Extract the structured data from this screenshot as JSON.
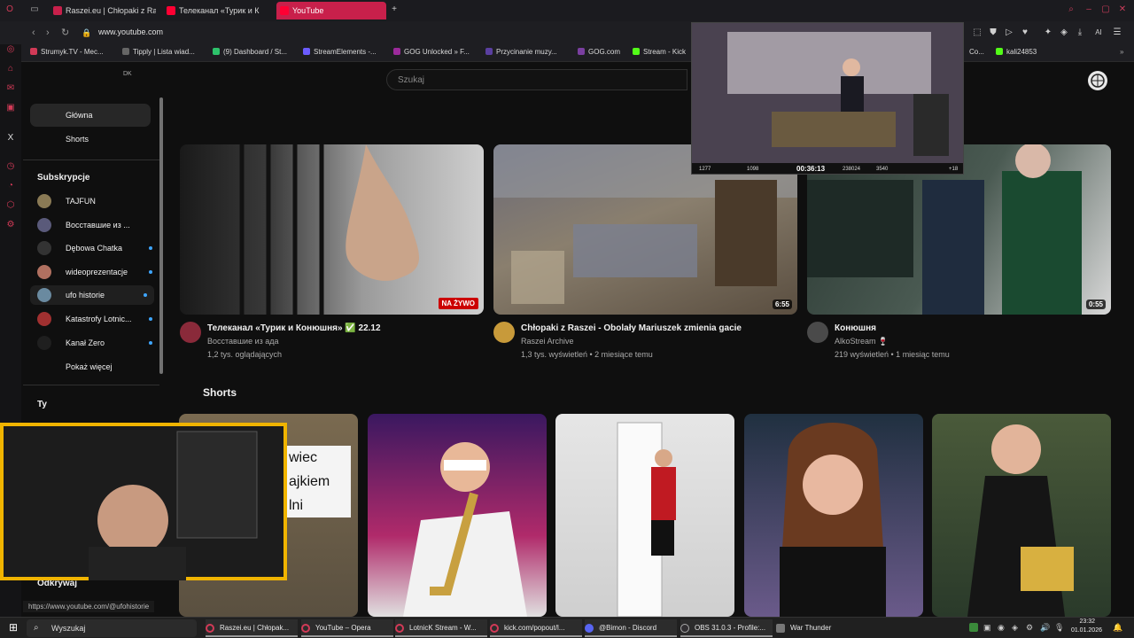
{
  "browser": {
    "tabs": [
      {
        "title": "Raszei.eu | Chłopaki z Ras",
        "active": false
      },
      {
        "title": "Телеканал «Турик и К",
        "active": false
      },
      {
        "title": "YouTube",
        "active": true
      }
    ],
    "url": "www.youtube.com",
    "bookmarks": [
      "Strumyk.TV - Mec...",
      "Tipply | Lista wiad...",
      "(9) Dashboard / St...",
      "StreamElements -...",
      "GOG Unlocked » F...",
      "Przycinanie muzy...",
      "GOG.com",
      "Stream - Kick",
      "Co...",
      "kali24853"
    ],
    "toolbar_ai": "AI",
    "accent": "#c8204b"
  },
  "youtube": {
    "country_code": "DK",
    "search_placeholder": "Szukaj",
    "nav": [
      {
        "label": "Główna",
        "active": true
      },
      {
        "label": "Shorts",
        "active": false
      }
    ],
    "subscriptions_heading": "Subskrypcje",
    "subscriptions": [
      {
        "name": "TAJFUN",
        "live": false,
        "color": "#8a7a55"
      },
      {
        "name": "Восставшие из ...",
        "live": false,
        "color": "#5a5a7a"
      },
      {
        "name": "Dębowa Chatka",
        "live": true,
        "color": "#333333"
      },
      {
        "name": "wideoprezentacje",
        "live": true,
        "color": "#b07060"
      },
      {
        "name": "ufo historie",
        "live": true,
        "color": "#6a8aa0"
      },
      {
        "name": "Katastrofy Lotnic...",
        "live": true,
        "color": "#a03030"
      },
      {
        "name": "Kanał Zero",
        "live": true,
        "color": "#1f1f1f"
      }
    ],
    "show_more": "Pokaż więcej",
    "you_heading": "Ty",
    "discover_heading": "Odkrywaj",
    "status_url": "https://www.youtube.com/@ufohistorie",
    "videos": [
      {
        "title": "Телеканал «Турик и Конюшня» ✅ 22.12",
        "channel": "Восставшие из ада",
        "meta": "1,2 tys. oglądających",
        "badge": "NA ŻYWO",
        "avatar_color": "#8a2a3a"
      },
      {
        "title": "Chłopaki z Raszei - Obolały Mariuszek zmienia gacie",
        "channel": "Raszei Archive",
        "meta": "1,3 tys. wyświetleń • 2 miesiące temu",
        "duration": "6:55",
        "avatar_color": "#c89a3a"
      },
      {
        "title": "Конюшня",
        "channel": "AlkoStream 🍷",
        "meta": "219 wyświetleń • 1 miesiąc temu",
        "duration": "0:55",
        "avatar_color": "#4a4a4a"
      }
    ],
    "shorts_heading": "Shorts",
    "shorts_first_caption": [
      "wiec",
      "ajkiem",
      "lni"
    ]
  },
  "overlays": {
    "pip_timer": "00:36:13",
    "pip_stats": [
      "1277",
      "1098",
      "238024",
      "3540",
      "+18"
    ]
  },
  "taskbar": {
    "search_label": "Wyszukaj",
    "apps": [
      {
        "label": "Raszei.eu | Chłopak...",
        "color": "#d23a57"
      },
      {
        "label": "YouTube – Opera",
        "color": "#d23a57"
      },
      {
        "label": "LotnicK Stream - W...",
        "color": "#d23a57"
      },
      {
        "label": "kick.com/popout/l...",
        "color": "#d23a57"
      },
      {
        "label": "@Bimon - Discord",
        "color": "#5865f2"
      },
      {
        "label": "OBS 31.0.3 - Profile:...",
        "color": "#302e31"
      },
      {
        "label": "War Thunder",
        "color": "#777777"
      }
    ],
    "time": "23:32",
    "date": "01.01.2026"
  }
}
